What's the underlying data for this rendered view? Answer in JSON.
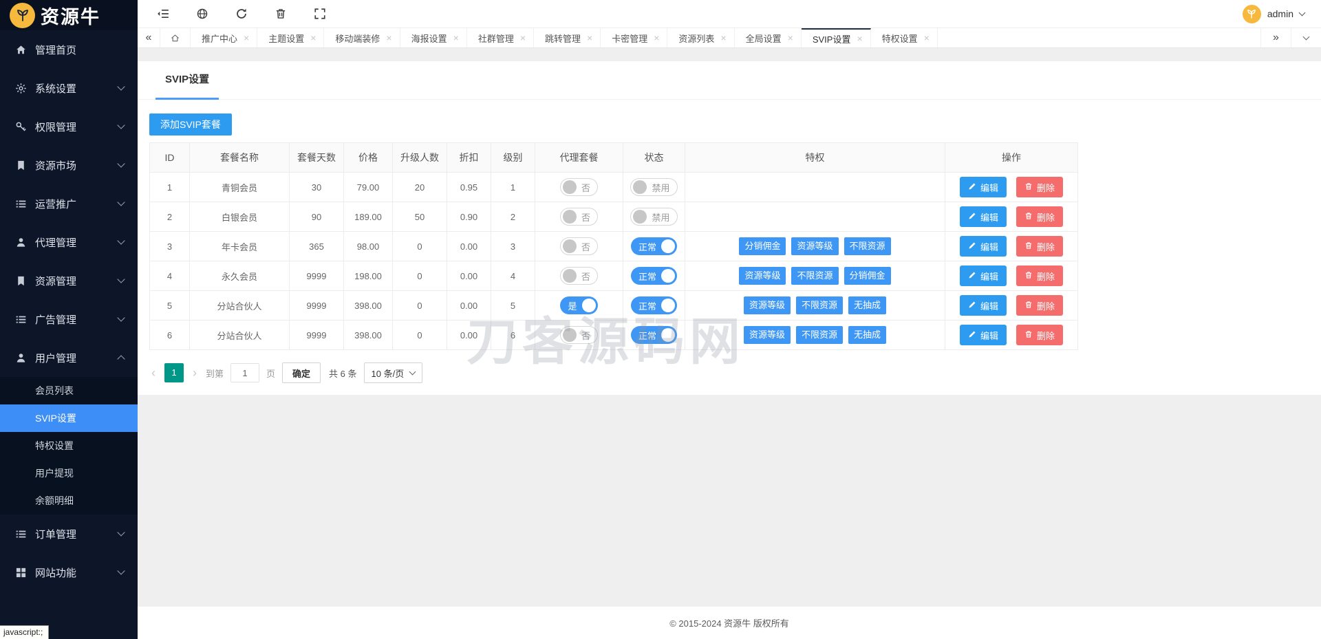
{
  "brand": {
    "name": "资源牛"
  },
  "topbar": {
    "icons": [
      "menu-fold-icon",
      "globe-icon",
      "refresh-icon",
      "trash-icon",
      "fullscreen-icon"
    ],
    "user": {
      "name": "admin"
    }
  },
  "tabbar": {
    "tabs": [
      "推广中心",
      "主题设置",
      "移动端装修",
      "海报设置",
      "社群管理",
      "跳转管理",
      "卡密管理",
      "资源列表",
      "全局设置",
      "SVIP设置",
      "特权设置"
    ],
    "active": "SVIP设置"
  },
  "sidebar": {
    "items": [
      {
        "label": "管理首页",
        "icon": "home-icon",
        "expandable": false
      },
      {
        "label": "系统设置",
        "icon": "gear-icon",
        "expandable": true
      },
      {
        "label": "权限管理",
        "icon": "key-icon",
        "expandable": true
      },
      {
        "label": "资源市场",
        "icon": "bookmark-icon",
        "expandable": true
      },
      {
        "label": "运营推广",
        "icon": "list-icon",
        "expandable": true
      },
      {
        "label": "代理管理",
        "icon": "person-icon",
        "expandable": true
      },
      {
        "label": "资源管理",
        "icon": "bookmark-icon",
        "expandable": true
      },
      {
        "label": "广告管理",
        "icon": "list-icon",
        "expandable": true
      },
      {
        "label": "用户管理",
        "icon": "person-icon",
        "expandable": true,
        "expanded": true,
        "children": [
          "会员列表",
          "SVIP设置",
          "特权设置",
          "用户提现",
          "余额明细"
        ],
        "active_child": "SVIP设置"
      },
      {
        "label": "订单管理",
        "icon": "list-icon",
        "expandable": true
      },
      {
        "label": "网站功能",
        "icon": "grid-icon",
        "expandable": true
      }
    ]
  },
  "page": {
    "title": "SVIP设置",
    "add_button_label": "添加SVIP套餐"
  },
  "table": {
    "columns": [
      "ID",
      "套餐名称",
      "套餐天数",
      "价格",
      "升级人数",
      "折扣",
      "级别",
      "代理套餐",
      "状态",
      "特权",
      "操作"
    ],
    "action_labels": {
      "edit": "编辑",
      "delete": "删除"
    },
    "rows": [
      {
        "id": "1",
        "name": "青铜会员",
        "days": "30",
        "price": "79.00",
        "upgrade": "20",
        "discount": "0.95",
        "level": "1",
        "agent": {
          "label": "否",
          "on": false
        },
        "status": {
          "label": "禁用",
          "on": false
        },
        "privileges": []
      },
      {
        "id": "2",
        "name": "白银会员",
        "days": "90",
        "price": "189.00",
        "upgrade": "50",
        "discount": "0.90",
        "level": "2",
        "agent": {
          "label": "否",
          "on": false
        },
        "status": {
          "label": "禁用",
          "on": false
        },
        "privileges": []
      },
      {
        "id": "3",
        "name": "年卡会员",
        "days": "365",
        "price": "98.00",
        "upgrade": "0",
        "discount": "0.00",
        "level": "3",
        "agent": {
          "label": "否",
          "on": false
        },
        "status": {
          "label": "正常",
          "on": true
        },
        "privileges": [
          "分销佣金",
          "资源等级",
          "不限资源"
        ]
      },
      {
        "id": "4",
        "name": "永久会员",
        "days": "9999",
        "price": "198.00",
        "upgrade": "0",
        "discount": "0.00",
        "level": "4",
        "agent": {
          "label": "否",
          "on": false
        },
        "status": {
          "label": "正常",
          "on": true
        },
        "privileges": [
          "资源等级",
          "不限资源",
          "分销佣金"
        ]
      },
      {
        "id": "5",
        "name": "分站合伙人",
        "days": "9999",
        "price": "398.00",
        "upgrade": "0",
        "discount": "0.00",
        "level": "5",
        "agent": {
          "label": "是",
          "on": true
        },
        "status": {
          "label": "正常",
          "on": true
        },
        "privileges": [
          "资源等级",
          "不限资源",
          "无抽成"
        ]
      },
      {
        "id": "6",
        "name": "分站合伙人",
        "days": "9999",
        "price": "398.00",
        "upgrade": "0",
        "discount": "0.00",
        "level": "6",
        "agent": {
          "label": "否",
          "on": false
        },
        "status": {
          "label": "正常",
          "on": true
        },
        "privileges": [
          "资源等级",
          "不限资源",
          "无抽成"
        ]
      }
    ]
  },
  "pagination": {
    "current_page": "1",
    "goto_prefix": "到第",
    "goto_value": "1",
    "goto_suffix": "页",
    "confirm_label": "确定",
    "total_label": "共 6 条",
    "page_size_label": "10 条/页"
  },
  "watermark": "刀客源码网",
  "footer": {
    "copyright": "© 2015-2024 资源牛 版权所有"
  },
  "status_bar": {
    "link_hint": "javascript:;"
  },
  "colors": {
    "accent_blue": "#3e97f5",
    "button_blue": "#2d9cf0",
    "danger_red": "#f56c6c",
    "pager_teal": "#009688",
    "sidebar_active_blue": "#3e8ef7",
    "logo_yellow": "#f6b83d",
    "sidebar_bg": "#0d1629"
  }
}
